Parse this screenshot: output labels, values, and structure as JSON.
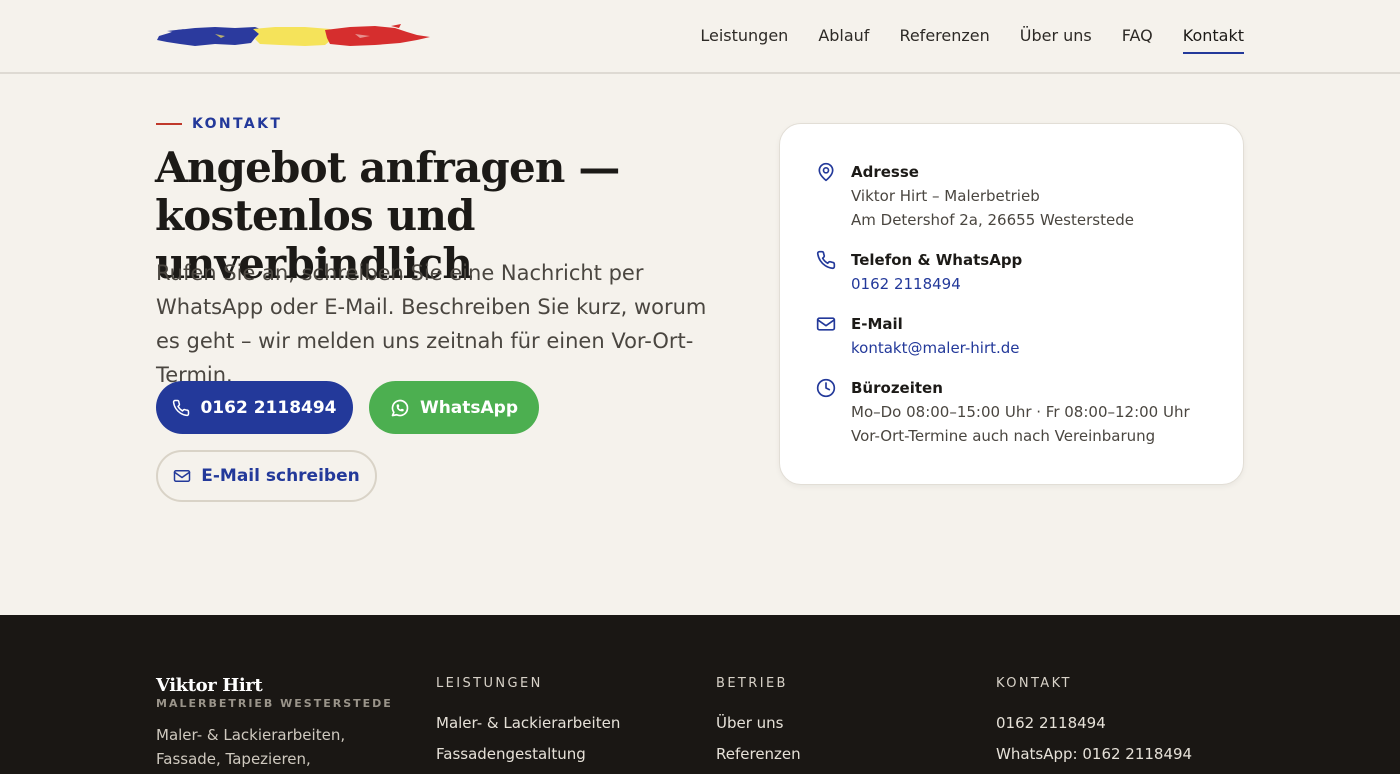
{
  "header": {
    "nav": [
      {
        "label": "Leistungen",
        "active": false
      },
      {
        "label": "Ablauf",
        "active": false
      },
      {
        "label": "Referenzen",
        "active": false
      },
      {
        "label": "Über uns",
        "active": false
      },
      {
        "label": "FAQ",
        "active": false
      },
      {
        "label": "Kontakt",
        "active": true
      }
    ]
  },
  "contact": {
    "eyebrow": "KONTAKT",
    "headline_line1": "Angebot anfragen —",
    "headline_line2": "kostenlos und unverbindlich",
    "intro": "Rufen Sie an, schreiben Sie eine Nachricht per WhatsApp oder E-Mail. Beschreiben Sie kurz, worum es geht – wir melden uns zeitnah für einen Vor-Ort-Termin.",
    "buttons": {
      "phone": "0162 2118494",
      "whatsapp": "WhatsApp",
      "email": "E-Mail schreiben"
    }
  },
  "card": {
    "address": {
      "title": "Adresse",
      "line1": "Viktor Hirt – Malerbetrieb",
      "line2": "Am Detershof 2a, 26655 Westerstede",
      "icon": "map-pin-icon"
    },
    "phone": {
      "title": "Telefon & WhatsApp",
      "value": "0162 2118494",
      "icon": "phone-icon"
    },
    "email": {
      "title": "E-Mail",
      "value": "kontakt@maler-hirt.de",
      "icon": "mail-icon"
    },
    "hours": {
      "title": "Bürozeiten",
      "line1": "Mo–Do 08:00–15:00 Uhr · Fr 08:00–12:00 Uhr",
      "line2": "Vor-Ort-Termine auch nach Vereinbarung",
      "icon": "clock-icon"
    }
  },
  "footer": {
    "brand": "Viktor Hirt",
    "subtitle": "MALERBETRIEB WESTERSTEDE",
    "description": "Maler- & Lackierarbeiten, Fassade, Tapezieren, Spachteltechnik,",
    "columns": {
      "leistungen": {
        "heading": "LEISTUNGEN",
        "links": [
          "Maler- & Lackierarbeiten",
          "Fassadengestaltung"
        ]
      },
      "betrieb": {
        "heading": "BETRIEB",
        "links": [
          "Über uns",
          "Referenzen"
        ]
      },
      "kontakt": {
        "heading": "KONTAKT",
        "links": [
          "0162 2118494",
          "WhatsApp: 0162 2118494"
        ]
      }
    }
  },
  "colors": {
    "primary": "#23399a",
    "whatsapp": "#4caf50",
    "accent_red": "#c0392b",
    "logo_blue": "#2b3a9e",
    "logo_yellow": "#f5e35a",
    "logo_red": "#d62e2e",
    "background": "#f5f2ec",
    "footer_bg": "#1a1714"
  }
}
